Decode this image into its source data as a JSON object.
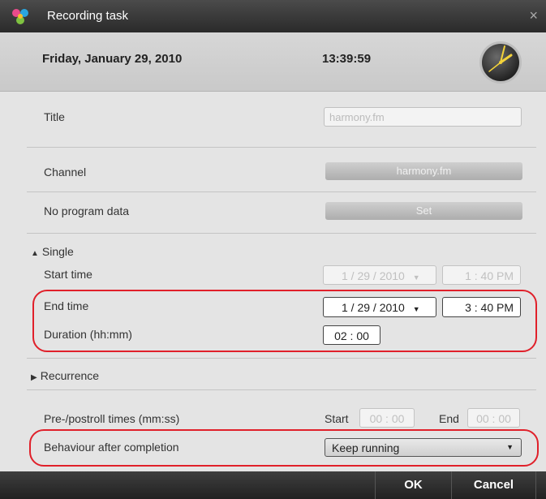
{
  "window": {
    "title": "Recording task",
    "close_glyph": "×"
  },
  "header": {
    "date": "Friday, January 29, 2010",
    "time": "13:39:59"
  },
  "title_row": {
    "label": "Title",
    "placeholder": "harmony.fm"
  },
  "channel_row": {
    "label": "Channel",
    "button": "harmony.fm"
  },
  "program_row": {
    "label": "No program data",
    "button": "Set"
  },
  "single": {
    "label": "Single",
    "start_label": "Start time",
    "start_date": "1 / 29 / 2010",
    "start_time": "1 : 40  PM",
    "end_label": "End time",
    "end_date": "1 / 29 / 2010",
    "end_time": "3 : 40  PM",
    "duration_label": "Duration (hh:mm)",
    "duration": "02 : 00"
  },
  "recurrence": {
    "label": "Recurrence"
  },
  "preroll": {
    "label": "Pre-/postroll times (mm:ss)",
    "start_label": "Start",
    "start_value": "00 : 00",
    "end_label": "End",
    "end_value": "00 : 00"
  },
  "behaviour": {
    "label": "Behaviour after completion",
    "value": "Keep running"
  },
  "footer": {
    "ok": "OK",
    "cancel": "Cancel"
  },
  "colors": {
    "highlight": "#e0202a",
    "titlebar": "#3a3a3a",
    "panel": "#e4e4e4"
  },
  "icons": {
    "app": "app-logo-icon",
    "clock": "analog-clock-icon",
    "dropdown": "chevron-down-icon"
  }
}
